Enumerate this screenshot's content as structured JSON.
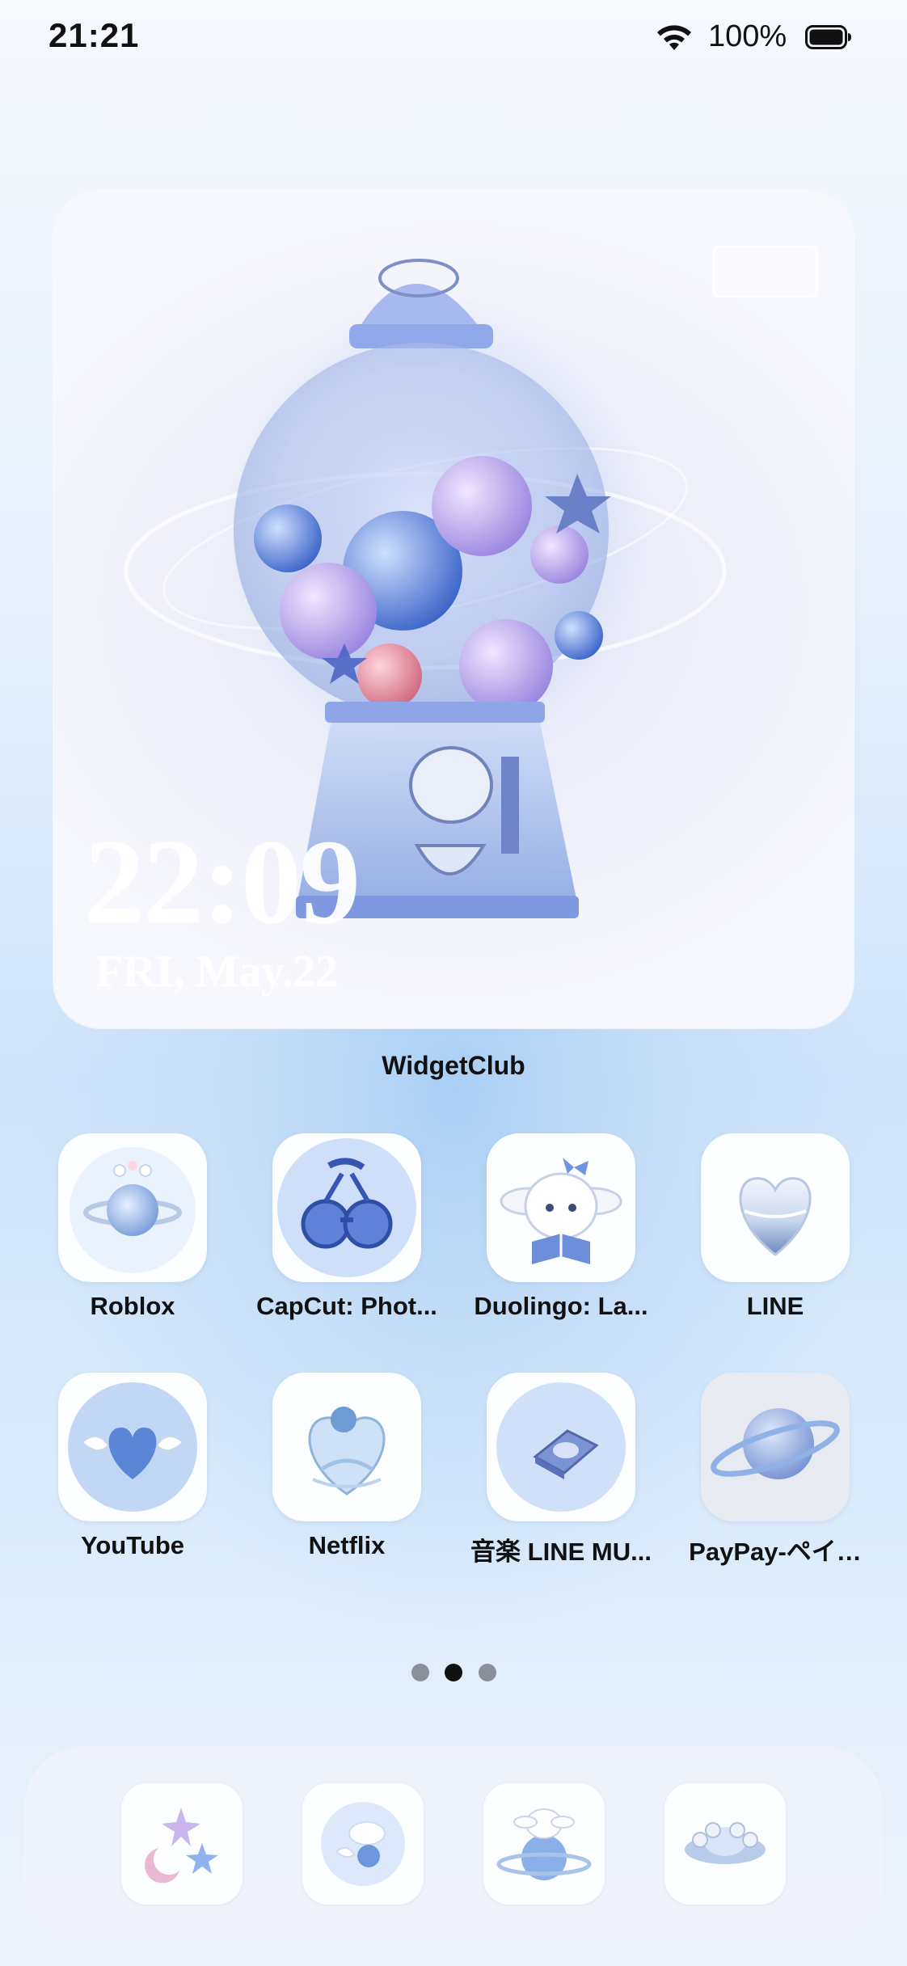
{
  "status_bar": {
    "time": "21:21",
    "battery_percent": "100%",
    "wifi_icon": "wifi-icon",
    "battery_icon": "battery-icon"
  },
  "widget": {
    "time": "22:09",
    "date": "FRI, May.22",
    "app_label": "WidgetClub",
    "art": "gumball-machine-planets-image"
  },
  "apps": [
    {
      "label": "Roblox",
      "icon": "planet-heart-icon"
    },
    {
      "label": "CapCut: Phot...",
      "icon": "cherry-glasses-icon"
    },
    {
      "label": "Duolingo: La...",
      "icon": "bunny-book-icon"
    },
    {
      "label": "LINE",
      "icon": "glass-heart-icon"
    },
    {
      "label": "YouTube",
      "icon": "winged-heart-icon"
    },
    {
      "label": "Netflix",
      "icon": "rose-heart-icon"
    },
    {
      "label": "音楽 LINE MU...",
      "icon": "music-box-icon"
    },
    {
      "label": "PayPay-ペイ…",
      "icon": "ringed-planet-icon"
    }
  ],
  "page_indicator": {
    "count": 3,
    "active_index": 1
  },
  "dock": [
    {
      "icon": "stars-moon-icon"
    },
    {
      "icon": "cloud-wings-icon"
    },
    {
      "icon": "bunny-planet-icon"
    },
    {
      "icon": "pearl-ufo-icon"
    }
  ]
}
